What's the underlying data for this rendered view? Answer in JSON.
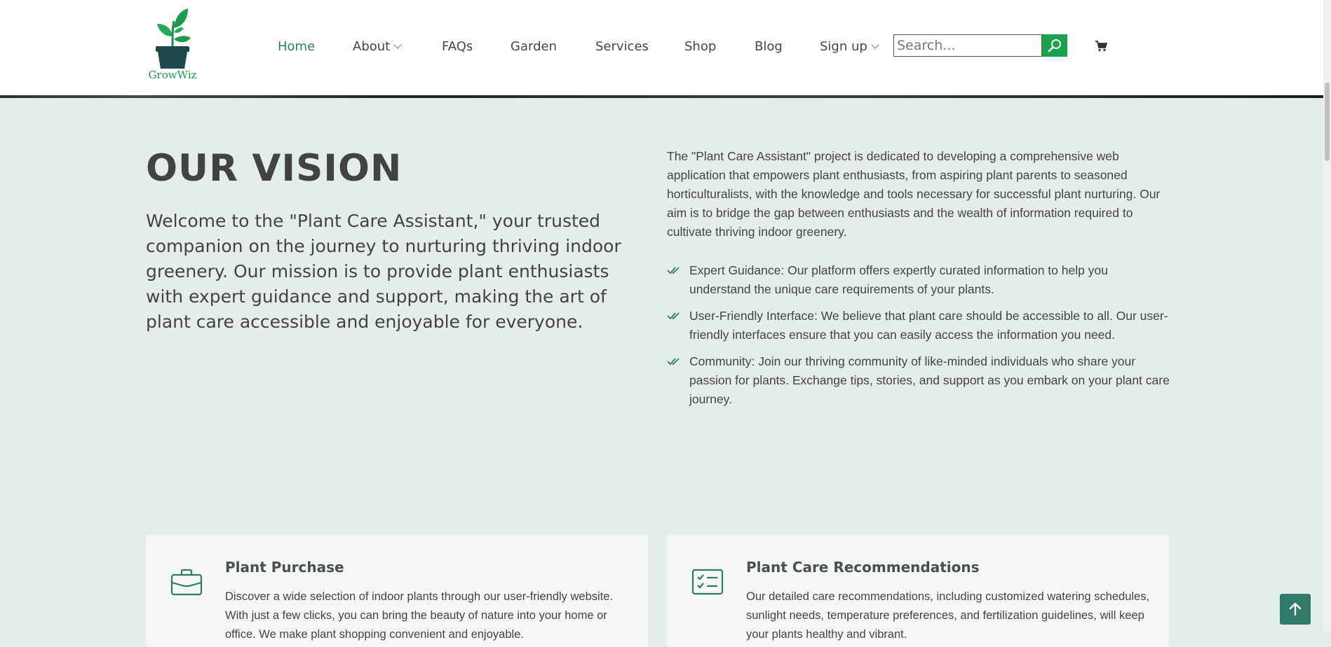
{
  "brand": {
    "name": "GrowWiz",
    "accent_color": "#1aa34a",
    "primary_color": "#2f7a68"
  },
  "nav": {
    "items": [
      {
        "label": "Home",
        "active": true
      },
      {
        "label": "About",
        "has_dropdown": true
      },
      {
        "label": "FAQs"
      },
      {
        "label": "Garden"
      },
      {
        "label": "Services"
      },
      {
        "label": "Shop"
      },
      {
        "label": "Blog"
      },
      {
        "label": "Sign up",
        "has_dropdown": true
      }
    ]
  },
  "search": {
    "placeholder": "Search...",
    "icon": "search-icon"
  },
  "cart": {
    "icon": "cart-icon"
  },
  "vision": {
    "title": "OUR VISION",
    "lead": "Welcome to the \"Plant Care Assistant,\" your trusted companion on the journey to nurturing thriving indoor greenery. Our mission is to provide plant enthusiasts with expert guidance and support, making the art of plant care accessible and enjoyable for everyone.",
    "intro": "The \"Plant Care Assistant\" project is dedicated to developing a comprehensive web application that empowers plant enthusiasts, from aspiring plant parents to seasoned horticulturalists, with the knowledge and tools necessary for successful plant nurturing. Our aim is to bridge the gap between enthusiasts and the wealth of information required to cultivate thriving indoor greenery.",
    "points": [
      "Expert Guidance: Our platform offers expertly curated information to help you understand the unique care requirements of your plants.",
      "User-Friendly Interface: We believe that plant care should be accessible to all. Our user-friendly interfaces ensure that you can easily access the information you need.",
      "Community: Join our thriving community of like-minded individuals who share your passion for plants. Exchange tips, stories, and support as you embark on your plant care journey."
    ]
  },
  "cards": [
    {
      "title": "Plant Purchase",
      "icon": "briefcase-icon",
      "text": "Discover a wide selection of indoor plants through our user-friendly website. With just a few clicks, you can bring the beauty of nature into your home or office. We make plant shopping convenient and enjoyable."
    },
    {
      "title": "Plant Care Recommendations",
      "icon": "checklist-icon",
      "text": "Our detailed care recommendations, including customized watering schedules, sunlight needs, temperature preferences, and fertilization guidelines, will keep your plants healthy and vibrant."
    }
  ],
  "back_to_top": {
    "icon": "arrow-up-icon"
  }
}
